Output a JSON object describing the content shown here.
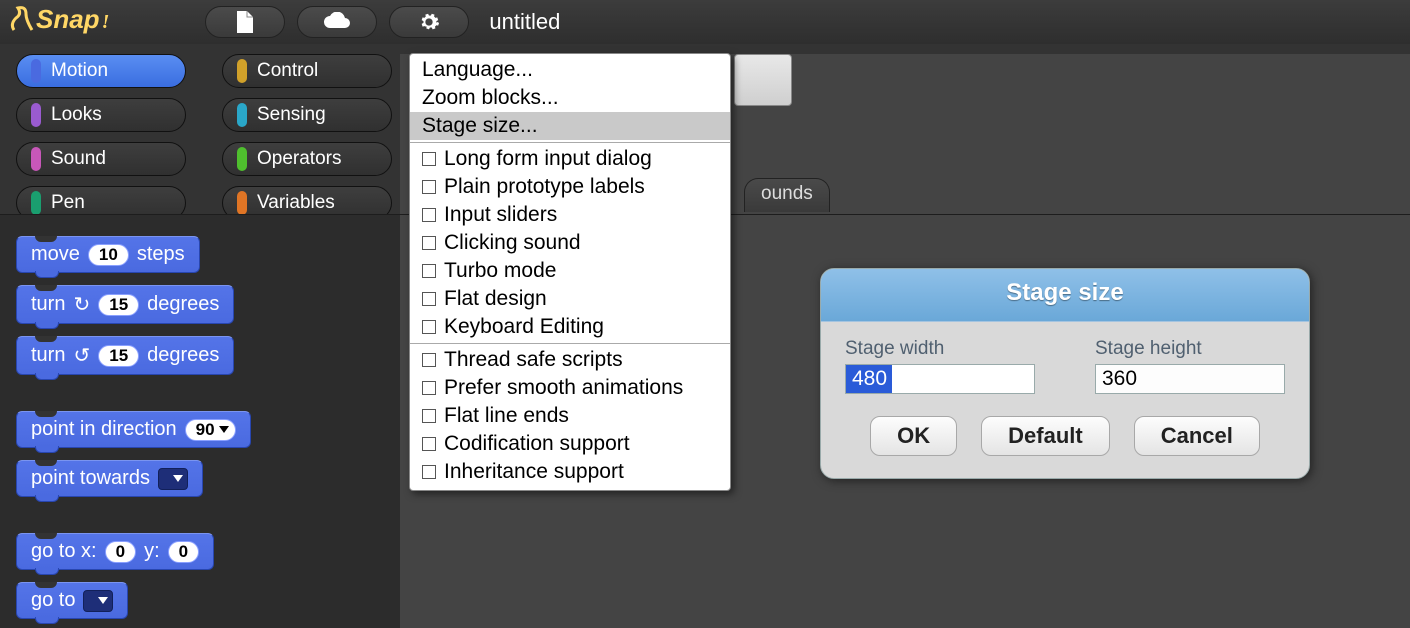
{
  "header": {
    "project_title": "untitled"
  },
  "categories": {
    "left": [
      {
        "label": "Motion",
        "color": "#4a6ae0",
        "active": true
      },
      {
        "label": "Looks",
        "color": "#9a5bd0",
        "active": false
      },
      {
        "label": "Sound",
        "color": "#c857b9",
        "active": false
      },
      {
        "label": "Pen",
        "color": "#1a9e6f",
        "active": false
      }
    ],
    "right": [
      {
        "label": "Control",
        "color": "#d1a12a",
        "active": false
      },
      {
        "label": "Sensing",
        "color": "#2aa7c9",
        "active": false
      },
      {
        "label": "Operators",
        "color": "#4fbf2e",
        "active": false
      },
      {
        "label": "Variables",
        "color": "#e07525",
        "active": false
      }
    ]
  },
  "tabs": {
    "sounds": "ounds"
  },
  "blocks": {
    "move": {
      "prefix": "move",
      "value": "10",
      "suffix": "steps"
    },
    "turn_cw": {
      "prefix": "turn",
      "value": "15",
      "suffix": "degrees"
    },
    "turn_ccw": {
      "prefix": "turn",
      "value": "15",
      "suffix": "degrees"
    },
    "point_dir": {
      "prefix": "point in direction",
      "value": "90"
    },
    "point_towards": {
      "prefix": "point towards"
    },
    "go_to_xy": {
      "prefix": "go to x:",
      "x": "0",
      "mid": "y:",
      "y": "0"
    },
    "go_to": {
      "prefix": "go to"
    }
  },
  "menu": {
    "top": [
      "Language...",
      "Zoom blocks...",
      "Stage size..."
    ],
    "group1": [
      "Long form input dialog",
      "Plain prototype labels",
      "Input sliders",
      "Clicking sound",
      "Turbo mode",
      "Flat design",
      "Keyboard Editing"
    ],
    "group2": [
      "Thread safe scripts",
      "Prefer smooth animations",
      "Flat line ends",
      "Codification support",
      "Inheritance support"
    ],
    "selected": "Stage size..."
  },
  "dialog": {
    "title": "Stage size",
    "width_label": "Stage width",
    "width_value": "480",
    "height_label": "Stage height",
    "height_value": "360",
    "ok": "OK",
    "default": "Default",
    "cancel": "Cancel"
  }
}
